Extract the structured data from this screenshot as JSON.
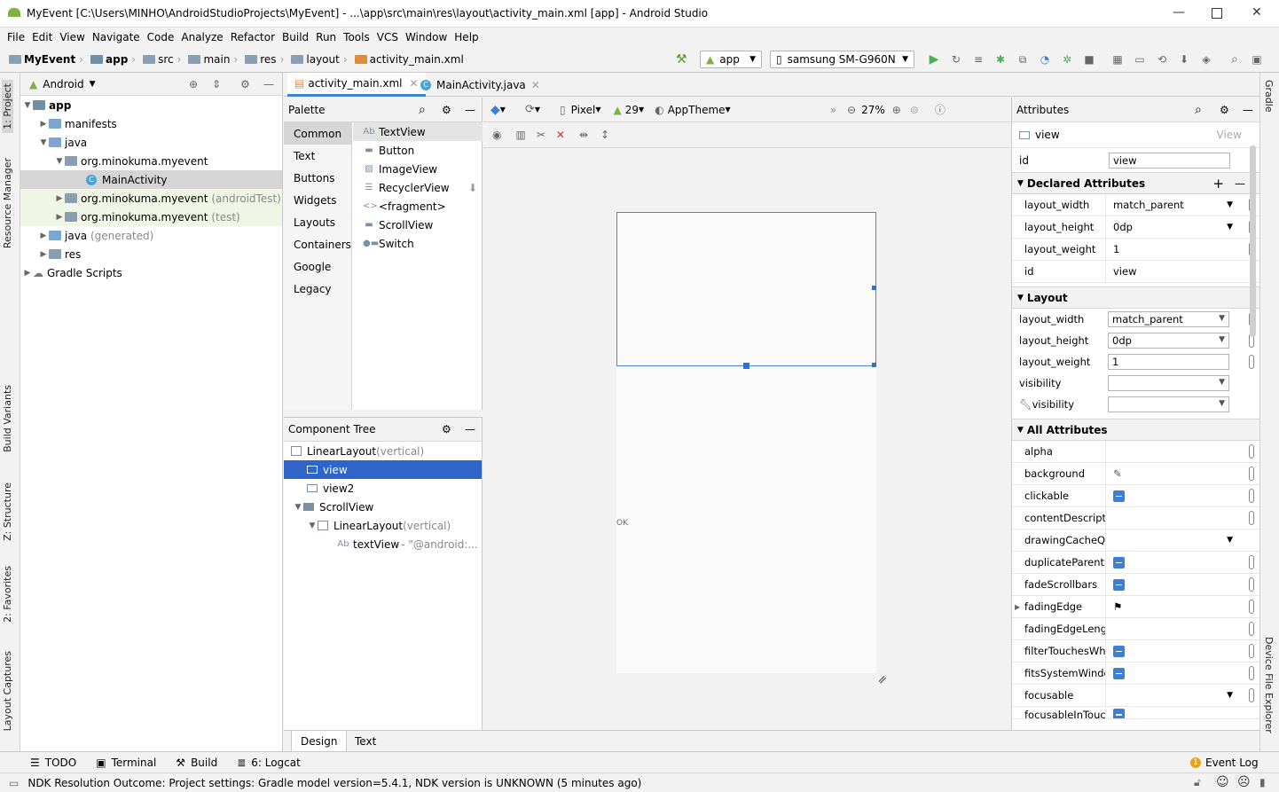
{
  "title": "MyEvent [C:\\Users\\MINHO\\AndroidStudioProjects\\MyEvent] - ...\\app\\src\\main\\res\\layout\\activity_main.xml [app] - Android Studio",
  "menu": [
    "File",
    "Edit",
    "View",
    "Navigate",
    "Code",
    "Analyze",
    "Refactor",
    "Build",
    "Run",
    "Tools",
    "VCS",
    "Window",
    "Help"
  ],
  "breadcrumbs": [
    "MyEvent",
    "app",
    "src",
    "main",
    "res",
    "layout",
    "activity_main.xml"
  ],
  "toolbar": {
    "module": "app",
    "device": "samsung SM-G960N"
  },
  "left_tabs": [
    "1: Project",
    "Resource Manager",
    "Build Variants",
    "Z: Structure",
    "2: Favorites",
    "Layout Captures"
  ],
  "right_tabs": [
    "Gradle",
    "Device File Explorer"
  ],
  "project": {
    "view_mode": "Android",
    "tree": [
      {
        "label": "app",
        "note": ""
      },
      {
        "label": "manifests",
        "note": ""
      },
      {
        "label": "java",
        "note": ""
      },
      {
        "label": "org.minokuma.myevent",
        "note": ""
      },
      {
        "label": "MainActivity",
        "note": ""
      },
      {
        "label": "org.minokuma.myevent",
        "note": "(androidTest)"
      },
      {
        "label": "org.minokuma.myevent",
        "note": "(test)"
      },
      {
        "label": "java",
        "note": "(generated)"
      },
      {
        "label": "res",
        "note": ""
      },
      {
        "label": "Gradle Scripts",
        "note": ""
      }
    ]
  },
  "editor_tabs": [
    "activity_main.xml",
    "MainActivity.java"
  ],
  "palette": {
    "title": "Palette",
    "categories": [
      "Common",
      "Text",
      "Buttons",
      "Widgets",
      "Layouts",
      "Containers",
      "Google",
      "Legacy"
    ],
    "items": [
      "TextView",
      "Button",
      "ImageView",
      "RecyclerView",
      "<fragment>",
      "ScrollView",
      "Switch"
    ]
  },
  "component_tree": {
    "title": "Component Tree",
    "nodes": [
      {
        "label": "LinearLayout",
        "note": "(vertical)"
      },
      {
        "label": "view",
        "note": ""
      },
      {
        "label": "view2",
        "note": ""
      },
      {
        "label": "ScrollView",
        "note": ""
      },
      {
        "label": "LinearLayout",
        "note": "(vertical)"
      },
      {
        "label": "textView",
        "note": "- \"@android:..."
      }
    ]
  },
  "design_toolbar": {
    "device": "Pixel",
    "api": "29",
    "theme": "AppTheme",
    "zoom": "27%"
  },
  "canvas": {
    "ok_text": "OK"
  },
  "bottom_editor_tabs": [
    "Design",
    "Text"
  ],
  "attributes": {
    "title": "Attributes",
    "component": "view",
    "component_type": "View",
    "id_label": "id",
    "id_value": "view",
    "declared_title": "Declared Attributes",
    "declared": [
      {
        "name": "layout_width",
        "value": "match_parent"
      },
      {
        "name": "layout_height",
        "value": "0dp"
      },
      {
        "name": "layout_weight",
        "value": "1"
      },
      {
        "name": "id",
        "value": "view"
      }
    ],
    "layout_title": "Layout",
    "layout": [
      {
        "name": "layout_width",
        "value": "match_parent"
      },
      {
        "name": "layout_height",
        "value": "0dp"
      },
      {
        "name": "layout_weight",
        "value": "1"
      },
      {
        "name": "visibility",
        "value": ""
      },
      {
        "name": "visibility",
        "value": ""
      }
    ],
    "all_title": "All Attributes",
    "all": [
      {
        "name": "alpha"
      },
      {
        "name": "background"
      },
      {
        "name": "clickable"
      },
      {
        "name": "contentDescriptio"
      },
      {
        "name": "drawingCacheQua"
      },
      {
        "name": "duplicateParentSt"
      },
      {
        "name": "fadeScrollbars"
      },
      {
        "name": "fadingEdge"
      },
      {
        "name": "fadingEdgeLength"
      },
      {
        "name": "filterTouchesWhen"
      },
      {
        "name": "fitsSystemWindow"
      },
      {
        "name": "focusable"
      },
      {
        "name": "focusableInTouchM"
      }
    ]
  },
  "bottom_tools": [
    "TODO",
    "Terminal",
    "Build",
    "6: Logcat",
    "Event Log"
  ],
  "status": "NDK Resolution Outcome: Project settings: Gradle model version=5.4.1, NDK version is UNKNOWN (5 minutes ago)"
}
